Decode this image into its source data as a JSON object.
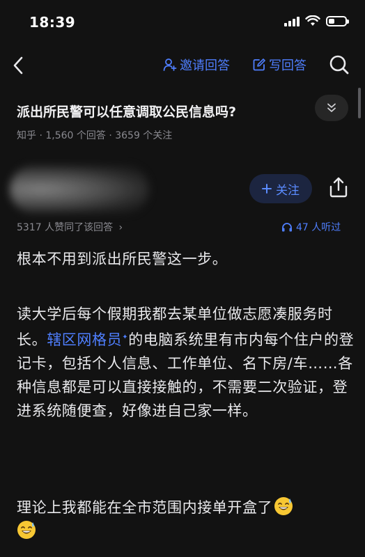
{
  "status_bar": {
    "time": "18:39",
    "battery_level": 0.35
  },
  "nav": {
    "invite_label": "邀请回答",
    "write_label": "写回答",
    "accent_color": "#4f7fff"
  },
  "question": {
    "title": "派出所民警可以任意调取公民信息吗?",
    "meta": "知乎 · 1,560 个回答 · 3659 个关注"
  },
  "author": {
    "follow_label": "关注",
    "agree_text": "5317 人赞同了该回答",
    "listen_text": "47 人听过"
  },
  "answer": {
    "p1": "根本不用到派出所民警这一步。",
    "p2_before": "读大学后每个假期我都去某单位做志愿凑服务时长。",
    "p2_link": "辖区网格员",
    "p2_after": "的电脑系统里有市内每个住户的登记卡，包括个人信息、工作单位、名下房/车……各种信息都是可以直接接触的，不需要二次验证，登进系统随便查，好像进自己家一样。",
    "p3": "理论上我都能在全市范围内接单开盒了"
  }
}
